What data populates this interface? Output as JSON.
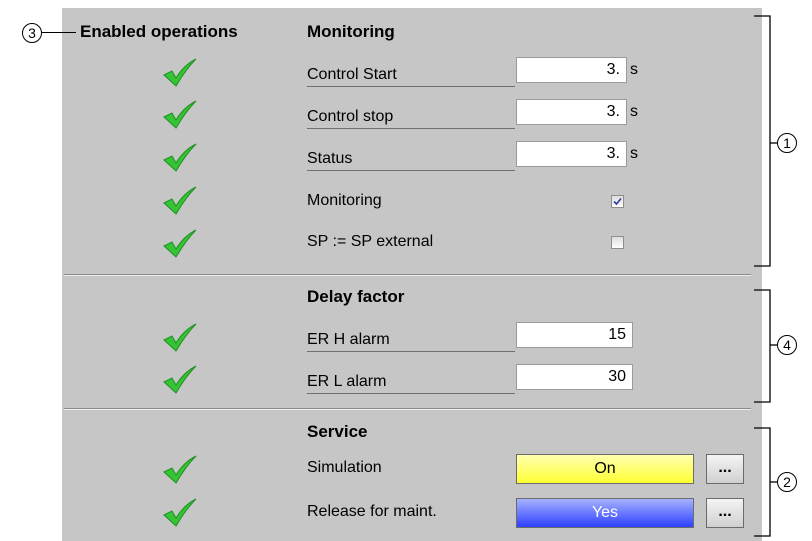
{
  "headers": {
    "enabled_operations": "Enabled operations",
    "monitoring": "Monitoring",
    "delay_factor": "Delay factor",
    "service": "Service"
  },
  "monitoring": {
    "control_start": {
      "label": "Control Start",
      "value": "3.",
      "unit": "s"
    },
    "control_stop": {
      "label": "Control stop",
      "value": "3.",
      "unit": "s"
    },
    "status": {
      "label": "Status",
      "value": "3.",
      "unit": "s"
    },
    "monitoring_opt": {
      "label": "Monitoring",
      "checked": true
    },
    "sp_external": {
      "label": "SP := SP external",
      "checked": false
    }
  },
  "delay": {
    "er_h_alarm": {
      "label": "ER H alarm",
      "value": "15"
    },
    "er_l_alarm": {
      "label": "ER L alarm",
      "value": "30"
    }
  },
  "service": {
    "simulation": {
      "label": "Simulation",
      "button": "On",
      "more": "..."
    },
    "release": {
      "label": "Release for maint.",
      "button": "Yes",
      "more": "..."
    }
  },
  "callouts": {
    "c1": "1",
    "c2": "2",
    "c3": "3",
    "c4": "4"
  },
  "colors": {
    "panel_bg": "#c6c6c6",
    "check_green": "#35c435",
    "on_yellow": "#ffff33",
    "yes_blue": "#2e40ff"
  },
  "icons": {
    "enabled": "checkmark-icon",
    "checked": "checkbox-checked-icon",
    "unchecked": "checkbox-unchecked-icon"
  }
}
